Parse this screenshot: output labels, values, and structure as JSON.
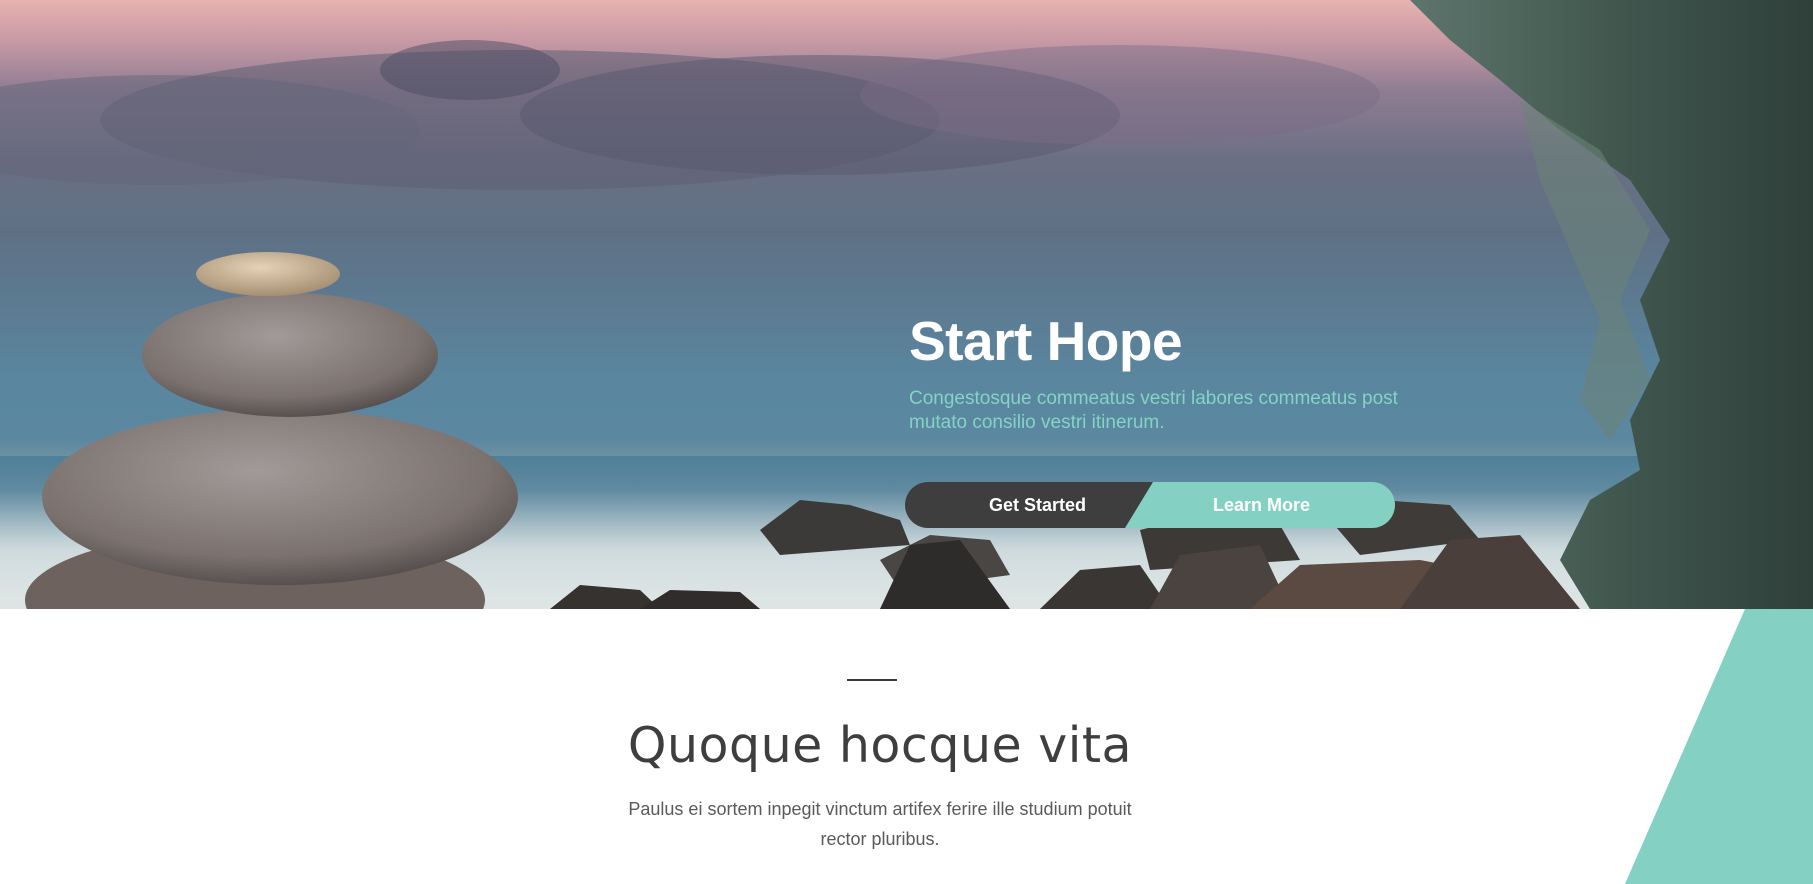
{
  "hero": {
    "title": "Start Hope",
    "subtitle": "Congestosque commeatus vestri labores commeatus post mutato consilio vestri itinerum.",
    "primary_button": "Get Started",
    "secondary_button": "Learn More"
  },
  "intro": {
    "title": "Quoque hocque vita",
    "text": "Paulus ei sortem inpegit vinctum artifex ferire ille studium potuit rector pluribus."
  },
  "colors": {
    "accent": "#84d1c4",
    "dark_button": "#3e3e3e",
    "title_text": "#3e3e3e",
    "body_text": "#5a5a5a"
  }
}
